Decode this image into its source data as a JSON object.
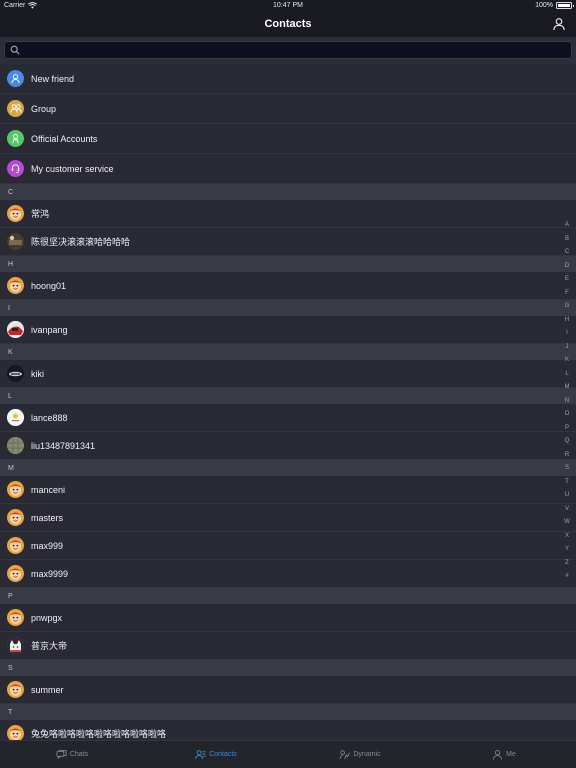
{
  "status_bar": {
    "carrier": "Carrier",
    "time": "10:47 PM",
    "battery": "100%",
    "battery_level": 1.0
  },
  "nav": {
    "title": "Contacts",
    "right_icon": "user-icon"
  },
  "search": {
    "placeholder": "",
    "value": ""
  },
  "features": [
    {
      "label": "New friend",
      "icon": "new-friend-icon",
      "color": "#4a8ae0"
    },
    {
      "label": "Group",
      "icon": "group-icon",
      "color": "#d4a84a"
    },
    {
      "label": "Official Accounts",
      "icon": "official-accounts-icon",
      "color": "#56c768"
    },
    {
      "label": "My customer service",
      "icon": "customer-service-icon",
      "color": "#b44ad8"
    }
  ],
  "sections": [
    {
      "letter": "C",
      "contacts": [
        "常鸿",
        "陈很坚决滚滚滚哈哈哈哈"
      ]
    },
    {
      "letter": "H",
      "contacts": [
        "hoong01"
      ]
    },
    {
      "letter": "I",
      "contacts": [
        "ivanpang"
      ]
    },
    {
      "letter": "K",
      "contacts": [
        "kiki"
      ]
    },
    {
      "letter": "L",
      "contacts": [
        "lance888",
        "liu13487891341"
      ]
    },
    {
      "letter": "M",
      "contacts": [
        "manceni",
        "masters",
        "max999",
        "max9999"
      ]
    },
    {
      "letter": "P",
      "contacts": [
        "pnwpgx",
        "普京大帝"
      ]
    },
    {
      "letter": "S",
      "contacts": [
        "summer"
      ]
    },
    {
      "letter": "T",
      "contacts": [
        "兔兔咯啦咯啦咯啦咯啦咯啦咯啦咯"
      ]
    }
  ],
  "index_letters": [
    "A",
    "B",
    "C",
    "D",
    "E",
    "F",
    "G",
    "H",
    "I",
    "J",
    "K",
    "L",
    "M",
    "N",
    "O",
    "P",
    "Q",
    "R",
    "S",
    "T",
    "U",
    "V",
    "W",
    "X",
    "Y",
    "Z",
    "#"
  ],
  "tabs": [
    {
      "label": "Chats",
      "icon": "chats-icon",
      "active": false
    },
    {
      "label": "Contacts",
      "icon": "contacts-icon",
      "active": true
    },
    {
      "label": "Dynamic",
      "icon": "dynamic-icon",
      "active": false
    },
    {
      "label": "Me",
      "icon": "me-icon",
      "active": false
    }
  ],
  "colors": {
    "accent": "#3b8ddb",
    "background": "#2a2a35",
    "header": "#3a3a47",
    "bar": "#1a1a22"
  }
}
